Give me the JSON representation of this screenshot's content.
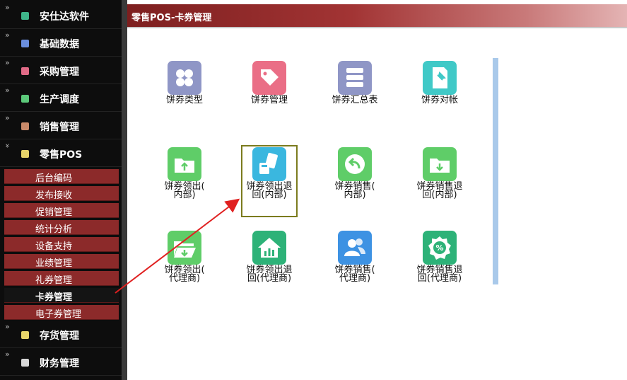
{
  "sidebar": {
    "categories": [
      {
        "label": "安仕达软件",
        "expanded": false
      },
      {
        "label": "基础数据",
        "expanded": false
      },
      {
        "label": "采购管理",
        "expanded": false
      },
      {
        "label": "生产调度",
        "expanded": false
      },
      {
        "label": "销售管理",
        "expanded": false
      },
      {
        "label": "零售POS",
        "expanded": true
      },
      {
        "label": "存货管理",
        "expanded": false
      },
      {
        "label": "财务管理",
        "expanded": false
      }
    ],
    "subitems": [
      "后台编码",
      "发布接收",
      "促销管理",
      "统计分析",
      "设备支持",
      "业绩管理",
      "礼券管理",
      "卡券管理",
      "电子券管理"
    ],
    "active_subitem": "卡券管理",
    "collapsed_marker": "»",
    "expanded_marker": "«"
  },
  "header": {
    "title": "零售POS-卡券管理"
  },
  "tiles": [
    {
      "label": "饼券类型",
      "icon": "grid-icon",
      "color": "#8f96c6"
    },
    {
      "label": "饼券管理",
      "icon": "tag-icon",
      "color": "#ea6e86"
    },
    {
      "label": "饼券汇总表",
      "icon": "database-icon",
      "color": "#8f96c6"
    },
    {
      "label": "饼券对帐",
      "icon": "pin-document-icon",
      "color": "#40c9c7"
    },
    {
      "label": "饼券领出(\n内部)",
      "icon": "folder-up-icon",
      "color": "#5fcd68"
    },
    {
      "label": "饼券领出退\n回(内部)",
      "icon": "cash-hand-icon",
      "color": "#3ab7df"
    },
    {
      "label": "饼券销售(\n内部)",
      "icon": "return-arrow-icon",
      "color": "#5fcd68"
    },
    {
      "label": "饼券销售退\n回(内部)",
      "icon": "folder-down-icon",
      "color": "#5fcd68"
    },
    {
      "label": "饼券领出(\n代理商)",
      "icon": "open-folder-icon",
      "color": "#5fcd68"
    },
    {
      "label": "饼券领出退\n回(代理商)",
      "icon": "house-chart-icon",
      "color": "#2db278"
    },
    {
      "label": "饼券销售(\n代理商)",
      "icon": "users-icon",
      "color": "#3d92e3"
    },
    {
      "label": "饼券销售退\n回(代理商)",
      "icon": "discount-badge-icon",
      "color": "#2db278"
    }
  ]
}
